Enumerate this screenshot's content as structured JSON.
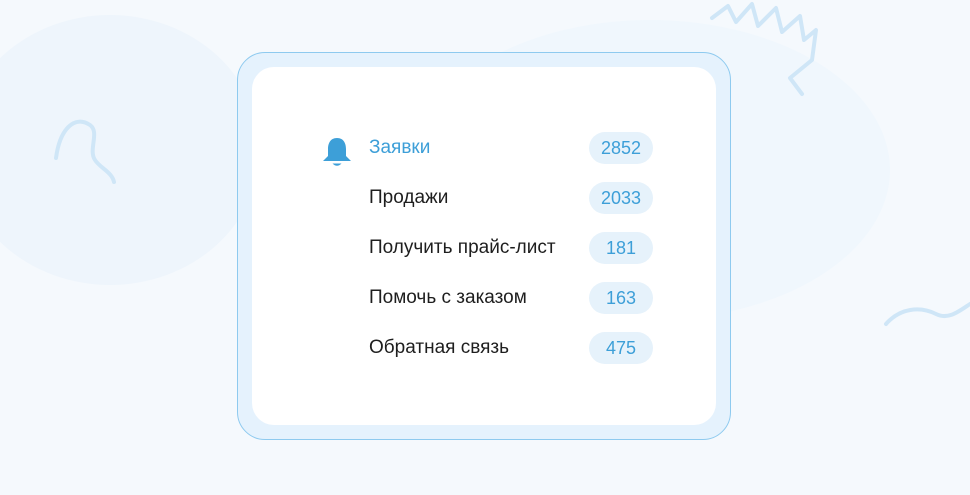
{
  "menu": {
    "active_icon": "bell-icon",
    "items": [
      {
        "label": "Заявки",
        "count": "2852",
        "active": true
      },
      {
        "label": "Продажи",
        "count": "2033"
      },
      {
        "label": "Получить прайс-лист",
        "count": "181"
      },
      {
        "label": "Помочь с заказом",
        "count": "163"
      },
      {
        "label": "Обратная связь",
        "count": "475"
      }
    ]
  },
  "colors": {
    "accent": "#3d9fd8",
    "badge_bg": "#e6f2fb",
    "card_border": "#8ecaef",
    "page_bg": "#f5f9fd"
  }
}
